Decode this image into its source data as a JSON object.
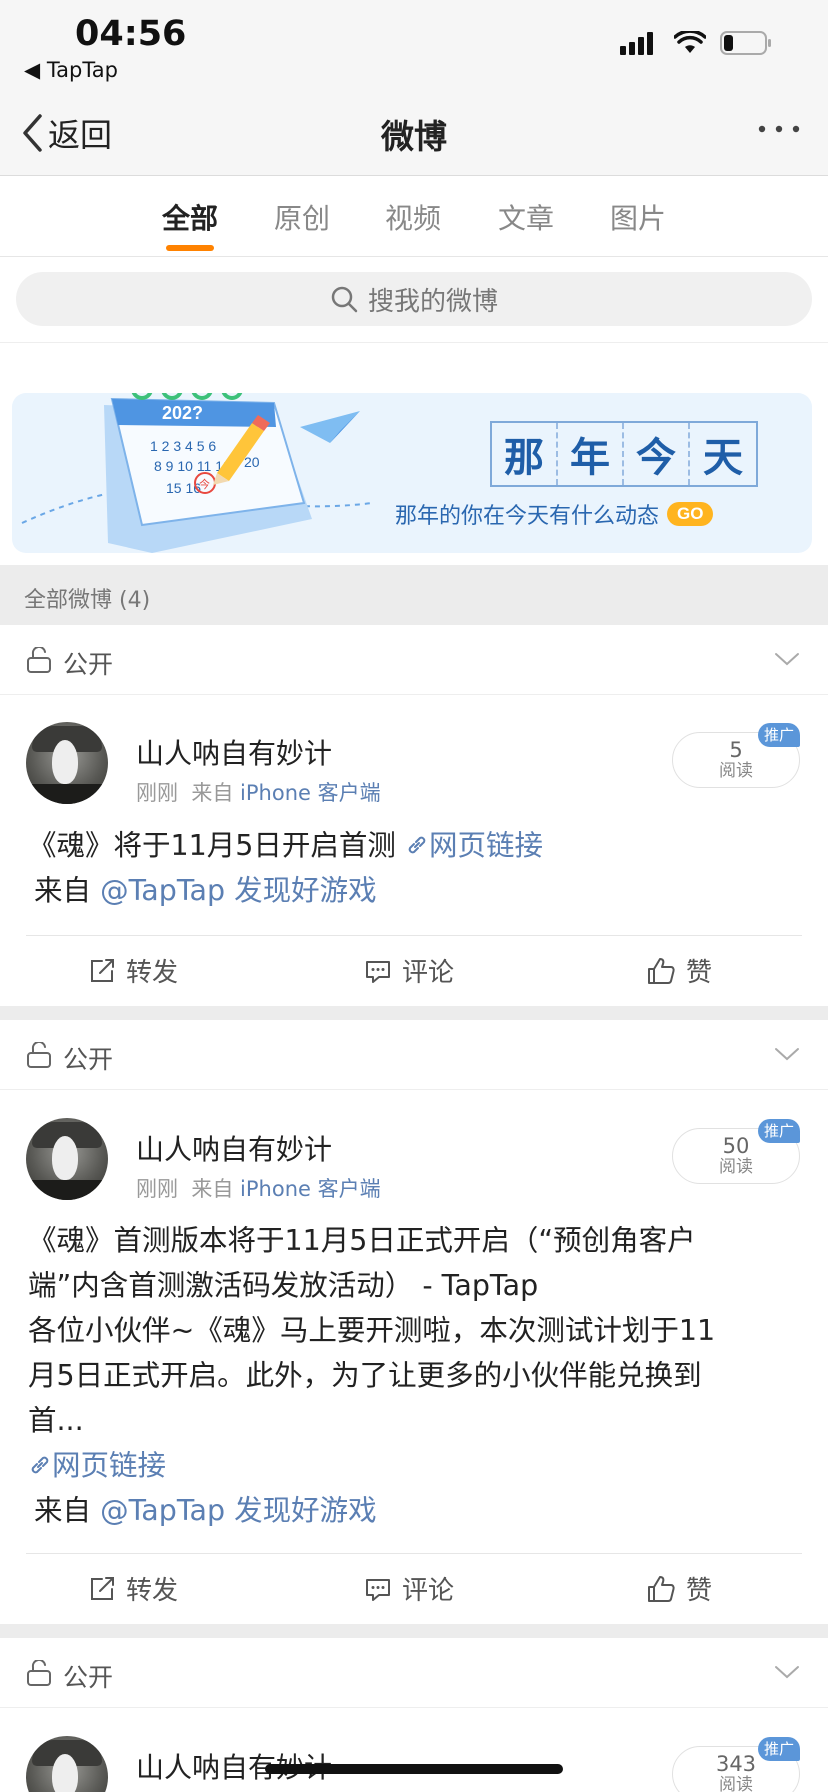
{
  "status_bar": {
    "time": "04:56",
    "back_app": "◀ TapTap"
  },
  "nav": {
    "back_label": "返回",
    "title": "微博"
  },
  "tabs": [
    {
      "label": "全部"
    },
    {
      "label": "原创"
    },
    {
      "label": "视频"
    },
    {
      "label": "文章"
    },
    {
      "label": "图片"
    }
  ],
  "search": {
    "placeholder": "搜我的微博"
  },
  "banner": {
    "title_chars": [
      "那",
      "年",
      "今",
      "天"
    ],
    "subtitle": "那年的你在今天有什么动态",
    "go_label": "GO",
    "calendar_year": "202?",
    "calendar_nums": "1 2 3 4 5 6",
    "calendar_nums2": "8 9 10 11 12",
    "calendar_nums3": "15 16",
    "calendar_marker": "今",
    "calendar_num_20": "20"
  },
  "count_bar": {
    "label": "全部微博 (4)"
  },
  "posts": [
    {
      "visibility": "公开",
      "author": "山人呐自有妙计",
      "time": "刚刚",
      "source_prefix": "来自",
      "source": "iPhone 客户端",
      "read_count": "5",
      "read_label": "阅读",
      "promo_tag": "推广",
      "text": "《魂》将于11月5日开启首测",
      "link_label": "网页链接",
      "from_prefix": "来自",
      "from_account": "@TapTap 发现好游戏",
      "repost_label": "转发",
      "comment_label": "评论",
      "like_label": "赞"
    },
    {
      "visibility": "公开",
      "author": "山人呐自有妙计",
      "time": "刚刚",
      "source_prefix": "来自",
      "source": "iPhone 客户端",
      "read_count": "50",
      "read_label": "阅读",
      "promo_tag": "推广",
      "text_line1": "《魂》首测版本将于11月5日正式开启（“预创角客户",
      "text_line2": "端”内含首测激活码发放活动） - TapTap",
      "text_line3": "各位小伙伴~《魂》马上要开测啦，本次测试计划于11",
      "text_line4": "月5日正式开启。此外，为了让更多的小伙伴能兑换到",
      "text_line5": "首...",
      "link_label": "网页链接",
      "from_prefix": "来自",
      "from_account": "@TapTap 发现好游戏",
      "repost_label": "转发",
      "comment_label": "评论",
      "like_label": "赞"
    },
    {
      "visibility": "公开",
      "author": "山人呐自有妙计",
      "read_count": "343",
      "read_label": "阅读",
      "promo_tag": "推广"
    }
  ],
  "colors": {
    "accent": "#ff8200",
    "link": "#5b7fb3",
    "promo": "#5b96d9",
    "banner_blue": "#1f5ea8"
  }
}
